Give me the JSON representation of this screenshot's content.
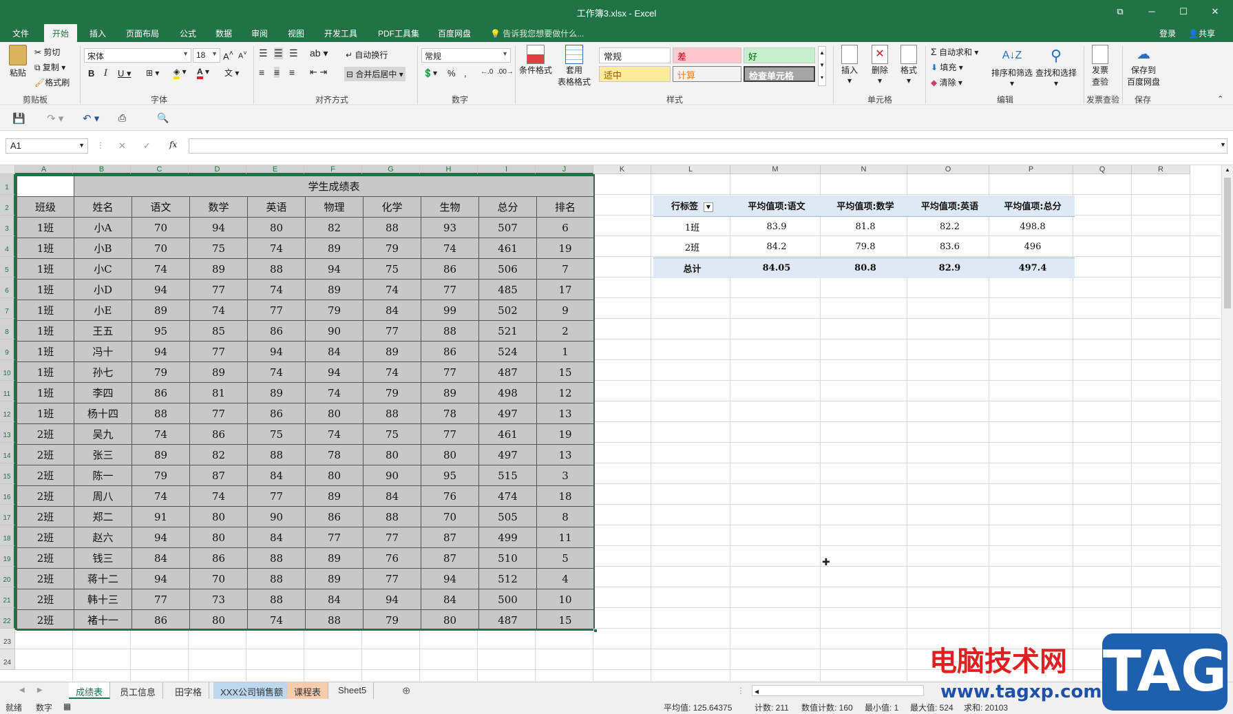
{
  "app": {
    "title": "工作簿3.xlsx - Excel"
  },
  "menu": {
    "items": [
      "文件",
      "开始",
      "插入",
      "页面布局",
      "公式",
      "数据",
      "审阅",
      "视图",
      "开发工具",
      "PDF工具集",
      "百度网盘"
    ],
    "search_hint": "告诉我您想要做什么...",
    "login": "登录",
    "share": "共享"
  },
  "ribbon": {
    "clipboard": {
      "paste": "粘贴",
      "cut": "剪切",
      "copy": "复制",
      "painter": "格式刷",
      "label": "剪贴板"
    },
    "font": {
      "name": "宋体",
      "size": "18",
      "label": "字体"
    },
    "align": {
      "wrap": "自动换行",
      "merge": "合并后居中",
      "label": "对齐方式"
    },
    "number": {
      "format": "常规",
      "label": "数字"
    },
    "styles": {
      "cond": "条件格式",
      "table": "套用\n表格格式",
      "normal": "常规",
      "bad": "差",
      "good": "好",
      "neutral": "适中",
      "calc": "计算",
      "check": "检查单元格",
      "label": "样式"
    },
    "cells": {
      "insert": "插入",
      "delete": "删除",
      "format": "格式",
      "label": "单元格"
    },
    "editing": {
      "autosum": "自动求和",
      "fill": "填充",
      "clear": "清除",
      "sort": "排序和筛选",
      "find": "查找和选择",
      "label": "编辑"
    },
    "invoice": {
      "btn": "发票\n查验",
      "label": "发票查验"
    },
    "save": {
      "btn": "保存到\n百度网盘",
      "label": "保存"
    }
  },
  "formula_bar": {
    "namebox": "A1",
    "fx": "fx",
    "content": ""
  },
  "columns": [
    "A",
    "B",
    "C",
    "D",
    "E",
    "F",
    "G",
    "H",
    "I",
    "J",
    "K",
    "L",
    "M",
    "N",
    "O",
    "P",
    "Q",
    "R"
  ],
  "rows": [
    "1",
    "2",
    "3",
    "4",
    "5",
    "6",
    "7",
    "8",
    "9",
    "10",
    "11",
    "12",
    "13",
    "14",
    "15",
    "16",
    "17",
    "18",
    "19",
    "20",
    "21",
    "22",
    "23",
    "24"
  ],
  "table": {
    "title": "学生成绩表",
    "headers": [
      "班级",
      "姓名",
      "语文",
      "数学",
      "英语",
      "物理",
      "化学",
      "生物",
      "总分",
      "排名"
    ],
    "rows": [
      [
        "1班",
        "小A",
        "70",
        "94",
        "80",
        "82",
        "88",
        "93",
        "507",
        "6"
      ],
      [
        "1班",
        "小B",
        "70",
        "75",
        "74",
        "89",
        "79",
        "74",
        "461",
        "19"
      ],
      [
        "1班",
        "小C",
        "74",
        "89",
        "88",
        "94",
        "75",
        "86",
        "506",
        "7"
      ],
      [
        "1班",
        "小D",
        "94",
        "77",
        "74",
        "89",
        "74",
        "77",
        "485",
        "17"
      ],
      [
        "1班",
        "小E",
        "89",
        "74",
        "77",
        "79",
        "84",
        "99",
        "502",
        "9"
      ],
      [
        "1班",
        "王五",
        "95",
        "85",
        "86",
        "90",
        "77",
        "88",
        "521",
        "2"
      ],
      [
        "1班",
        "冯十",
        "94",
        "77",
        "94",
        "84",
        "89",
        "86",
        "524",
        "1"
      ],
      [
        "1班",
        "孙七",
        "79",
        "89",
        "74",
        "94",
        "74",
        "77",
        "487",
        "15"
      ],
      [
        "1班",
        "李四",
        "86",
        "81",
        "89",
        "74",
        "79",
        "89",
        "498",
        "12"
      ],
      [
        "1班",
        "杨十四",
        "88",
        "77",
        "86",
        "80",
        "88",
        "78",
        "497",
        "13"
      ],
      [
        "2班",
        "吴九",
        "74",
        "86",
        "75",
        "74",
        "75",
        "77",
        "461",
        "19"
      ],
      [
        "2班",
        "张三",
        "89",
        "82",
        "88",
        "78",
        "80",
        "80",
        "497",
        "13"
      ],
      [
        "2班",
        "陈一",
        "79",
        "87",
        "84",
        "80",
        "90",
        "95",
        "515",
        "3"
      ],
      [
        "2班",
        "周八",
        "74",
        "74",
        "77",
        "89",
        "84",
        "76",
        "474",
        "18"
      ],
      [
        "2班",
        "郑二",
        "91",
        "80",
        "90",
        "86",
        "88",
        "70",
        "505",
        "8"
      ],
      [
        "2班",
        "赵六",
        "94",
        "80",
        "84",
        "77",
        "77",
        "87",
        "499",
        "11"
      ],
      [
        "2班",
        "钱三",
        "84",
        "86",
        "88",
        "89",
        "76",
        "87",
        "510",
        "5"
      ],
      [
        "2班",
        "蒋十二",
        "94",
        "70",
        "88",
        "89",
        "77",
        "94",
        "512",
        "4"
      ],
      [
        "2班",
        "韩十三",
        "77",
        "73",
        "88",
        "84",
        "94",
        "84",
        "500",
        "10"
      ],
      [
        "2班",
        "褚十一",
        "86",
        "80",
        "74",
        "88",
        "79",
        "80",
        "487",
        "15"
      ]
    ]
  },
  "pivot": {
    "headers": [
      "行标签",
      "平均值项:语文",
      "平均值项:数学",
      "平均值项:英语",
      "平均值项:总分"
    ],
    "rows": [
      [
        "1班",
        "83.9",
        "81.8",
        "82.2",
        "498.8"
      ],
      [
        "2班",
        "84.2",
        "79.8",
        "83.6",
        "496"
      ]
    ],
    "total": [
      "总计",
      "84.05",
      "80.8",
      "82.9",
      "497.4"
    ]
  },
  "sheets": [
    "成绩表",
    "员工信息",
    "田字格",
    "XXX公司销售额",
    "课程表",
    "Sheet5"
  ],
  "status": {
    "ready": "就绪",
    "mode": "数字",
    "avg": "平均值: 125.64375",
    "count": "计数: 211",
    "numcount": "数值计数: 160",
    "min": "最小值: 1",
    "max": "最大值: 524",
    "sum": "求和: 20103"
  },
  "watermark": {
    "text": "电脑技术网",
    "url": "www.tagxp.com",
    "logo": "TAG"
  }
}
